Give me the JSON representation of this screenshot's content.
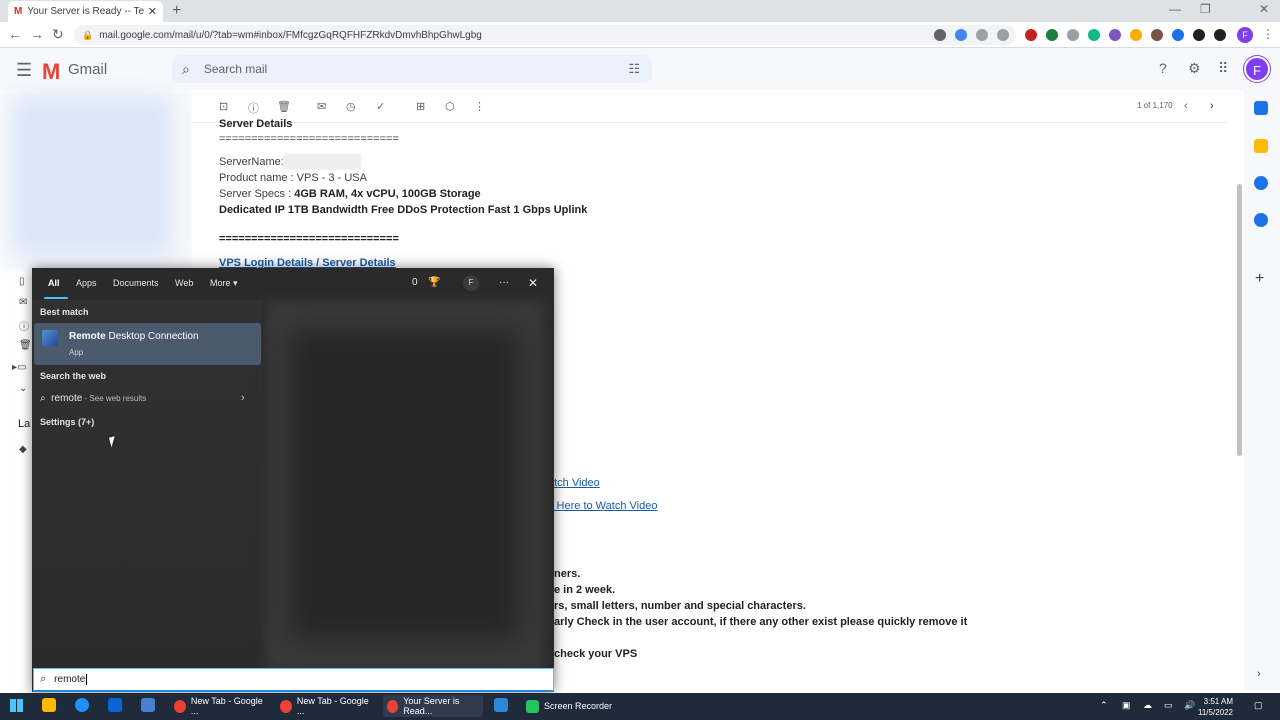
{
  "browser": {
    "active_tab_title": "Your Server is Ready -- Test Serve",
    "url": "mail.google.com/mail/u/0/?tab=wm#inbox/FMfcgzGqRQFHFZRkdvDmvhBhpGhwLgbg",
    "profile_initial": "F"
  },
  "gmail": {
    "app_name": "Gmail",
    "search_placeholder": "Search mail",
    "avatar_initial": "F",
    "pager": "1 of 1,170"
  },
  "email": {
    "section_title": "Server Details",
    "separator1": "============================",
    "server_name_label": "ServerName:",
    "product_name": "Product name : VPS - 3 - USA",
    "specs_label": "Server Specs : ",
    "specs_value": "4GB RAM, 4x vCPU, 100GB Storage",
    "specs_line2": "Dedicated IP 1TB Bandwidth Free DDoS Protection Fast 1 Gbps Uplink",
    "separator2": "============================",
    "login_heading": "VPS Login Details / Server Details",
    "link1": "atch Video",
    "link2": "k Here to Watch Video",
    "partial_lines": [
      "ners.",
      "e in 2 week.",
      "rs, small letters, number and special characters.",
      "arly Check in the user account, if there any other exist please quickly remove it",
      "check your VPS"
    ]
  },
  "left_nav": {
    "partial_label": "La"
  },
  "start_search": {
    "tabs": [
      "All",
      "Apps",
      "Documents",
      "Web",
      "More"
    ],
    "points": "0",
    "avatar_initial": "F",
    "best_match_label": "Best match",
    "best_match_name_bold": "Remote",
    "best_match_name_rest": " Desktop Connection",
    "best_match_type": "App",
    "search_web_label": "Search the web",
    "web_query": "remote",
    "web_suffix": " - See web results",
    "settings_label": "Settings (7+)",
    "query": "remote"
  },
  "taskbar": {
    "apps": [
      {
        "label": "New Tab - Google ..."
      },
      {
        "label": "New Tab - Google ..."
      },
      {
        "label": "Your Server is Read..."
      },
      {
        "label": "Screen Recorder"
      }
    ],
    "time": "3:51 AM",
    "date": "11/5/2022"
  },
  "colors": {
    "gmail_red": "#ea4335",
    "accent_blue": "#4cc2ff",
    "avatar_purple": "#7e3ff2",
    "taskbar_bg": "#1f2a3b"
  }
}
